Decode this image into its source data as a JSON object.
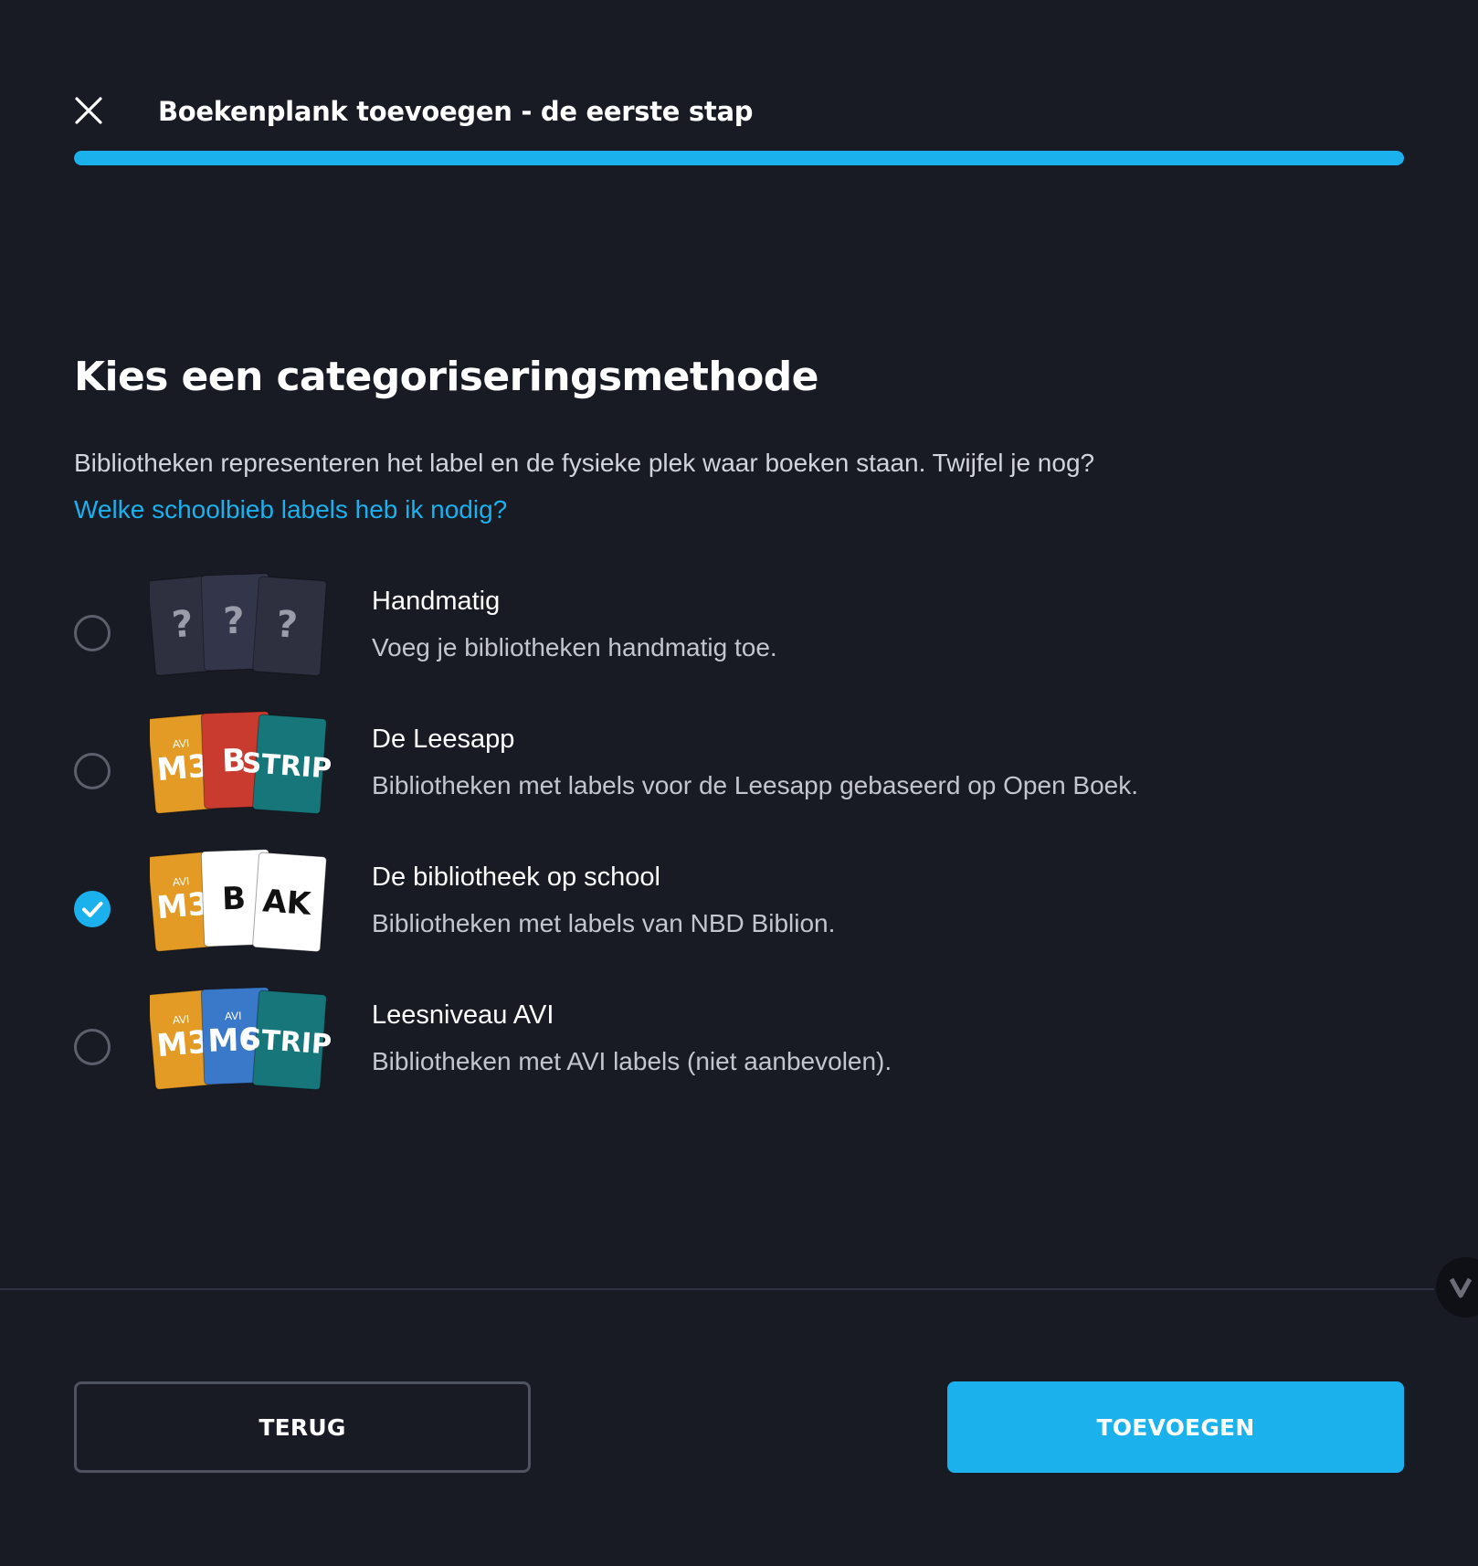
{
  "header": {
    "title": "Boekenplank toevoegen - de eerste stap",
    "close_icon": "close-icon",
    "progress_fraction": 1.0,
    "accent_color": "#1ab1ec"
  },
  "main": {
    "heading": "Kies een categoriseringsmethode",
    "description": "Bibliotheken representeren het label en de fysieke plek waar boeken staan. Twijfel je nog?",
    "help_link": "Welke schoolbieb labels heb ik nodig?"
  },
  "options": [
    {
      "title": "Handmatig",
      "description": "Voeg je bibliotheken handmatig toe.",
      "selected": false,
      "cards": [
        {
          "top": "",
          "text": "?",
          "bg": "#2e3040",
          "fg": "#9a9caa"
        },
        {
          "top": "",
          "text": "?",
          "bg": "#33364a",
          "fg": "#9a9caa"
        },
        {
          "top": "",
          "text": "?",
          "bg": "#2e3040",
          "fg": "#9a9caa"
        }
      ]
    },
    {
      "title": "De Leesapp",
      "description": "Bibliotheken met labels voor de Leesapp gebaseerd op Open Boek.",
      "selected": false,
      "cards": [
        {
          "top": "AVI",
          "text": "M3",
          "bg": "#e39b26",
          "fg": "#ffffff"
        },
        {
          "top": "",
          "text": "B",
          "bg": "#c93a2f",
          "fg": "#ffffff"
        },
        {
          "top": "",
          "text": "STRIP",
          "bg": "#16767a",
          "fg": "#ffffff"
        }
      ]
    },
    {
      "title": "De bibliotheek op school",
      "description": "Bibliotheken met labels van NBD Biblion.",
      "selected": true,
      "cards": [
        {
          "top": "AVI",
          "text": "M3",
          "bg": "#e39b26",
          "fg": "#ffffff"
        },
        {
          "top": "",
          "text": "B",
          "bg": "#ffffff",
          "fg": "#111111"
        },
        {
          "top": "",
          "text": "AK",
          "bg": "#ffffff",
          "fg": "#111111"
        }
      ]
    },
    {
      "title": "Leesniveau AVI",
      "description": "Bibliotheken met AVI labels (niet aanbevolen).",
      "selected": false,
      "cards": [
        {
          "top": "AVI",
          "text": "M3",
          "bg": "#e39b26",
          "fg": "#ffffff"
        },
        {
          "top": "AVI",
          "text": "M6",
          "bg": "#3a78c9",
          "fg": "#ffffff"
        },
        {
          "top": "",
          "text": "STRIP",
          "bg": "#16767a",
          "fg": "#ffffff"
        }
      ]
    }
  ],
  "footer": {
    "back_label": "TERUG",
    "add_label": "TOEVOEGEN",
    "scroll_icon": "chevron-down-icon"
  }
}
